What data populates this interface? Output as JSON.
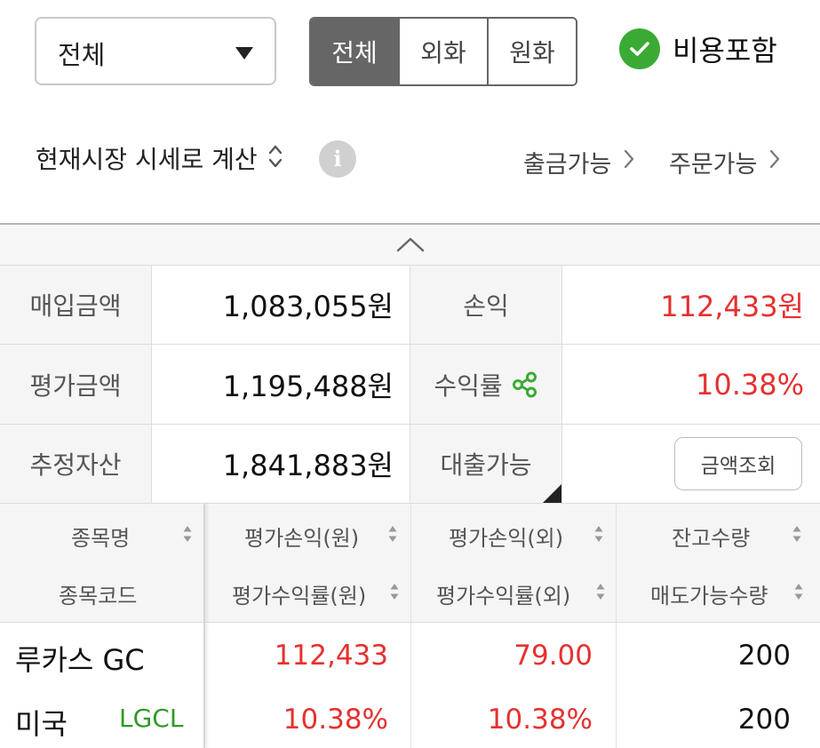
{
  "filter": {
    "dropdown_value": "전체"
  },
  "currency_tabs": [
    {
      "label": "전체",
      "active": true
    },
    {
      "label": "외화",
      "active": false
    },
    {
      "label": "원화",
      "active": false
    }
  ],
  "fee_toggle": {
    "label": "비용포함",
    "checked": true
  },
  "calc_mode": {
    "label": "현재시장 시세로 계산"
  },
  "info_icon": "i",
  "links": {
    "withdrawable": "출금가능",
    "orderable": "주문가능"
  },
  "summary": {
    "purchase_label": "매입금액",
    "purchase_value": "1,083,055원",
    "pnl_label": "손익",
    "pnl_value": "112,433원",
    "eval_label": "평가금액",
    "eval_value": "1,195,488원",
    "return_label": "수익률",
    "return_value": "10.38%",
    "assets_label": "추정자산",
    "assets_value": "1,841,883원",
    "loan_label": "대출가능",
    "loan_button": "금액조회"
  },
  "columns": {
    "name": "종목명",
    "code": "종목코드",
    "pnl_krw": "평가손익(원)",
    "ret_krw": "평가수익률(원)",
    "pnl_fx": "평가손익(외)",
    "ret_fx": "평가수익률(외)",
    "qty": "잔고수량",
    "sellable": "매도가능수량"
  },
  "holdings": [
    {
      "name": "루카스 GC",
      "market": "미국",
      "code": "LGCL",
      "pnl_krw": "112,433",
      "ret_krw": "10.38%",
      "pnl_fx": "79.00",
      "ret_fx": "10.38%",
      "qty": "200",
      "sellable": "200"
    }
  ],
  "colors": {
    "accent_green": "#3aaa35",
    "profit_red": "#e5312f",
    "active_tab": "#666666",
    "code_green": "#2f9a28"
  }
}
